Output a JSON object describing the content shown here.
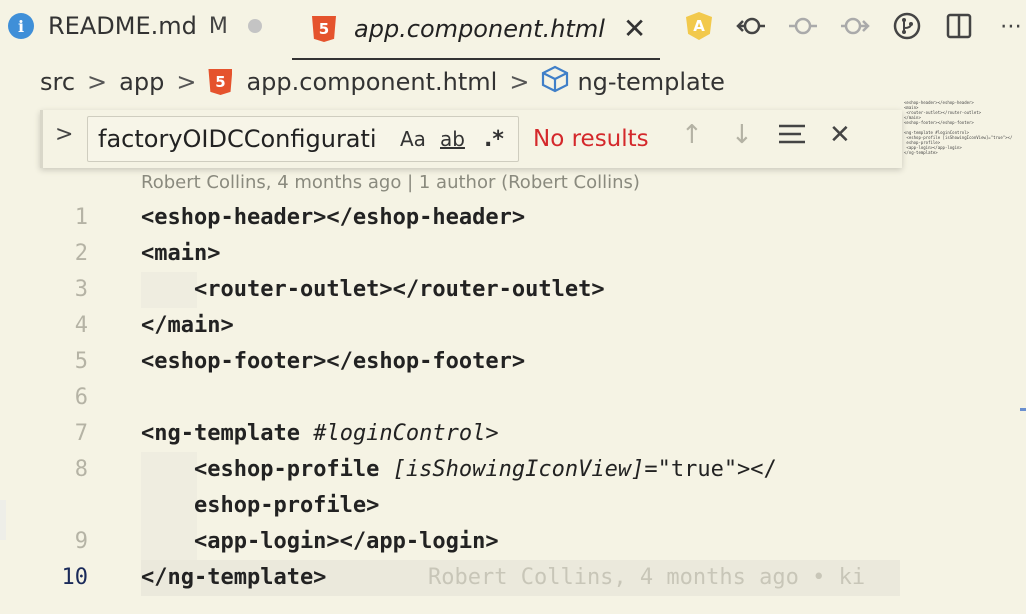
{
  "tabs": [
    {
      "label": "README.md",
      "modified": "M"
    },
    {
      "label": "app.component.html"
    }
  ],
  "breadcrumb": [
    "src",
    "app",
    "app.component.html",
    "ng-template"
  ],
  "find": {
    "value": "factoryOIDCConfigurati",
    "match_case": "Aa",
    "whole_word": "ab",
    "regex": ".*",
    "status": "No results"
  },
  "blame_header": "Robert Collins, 4 months ago | 1 author (Robert Collins)",
  "inline_blame": "Robert Collins, 4 months ago • ki",
  "line_numbers": [
    "1",
    "2",
    "3",
    "4",
    "5",
    "6",
    "7",
    "8",
    "9",
    "10"
  ],
  "code_lines": [
    "<eshop-header></eshop-header>",
    "<main>",
    "    <router-outlet></router-outlet>",
    "</main>",
    "<eshop-footer></eshop-footer>",
    "",
    "<ng-template #loginControl>",
    "    <eshop-profile [isShowingIconView]=\"true\"></",
    "    eshop-profile>",
    "    <app-login></app-login>",
    "</ng-template>"
  ],
  "colors": {
    "background": "#f5f3e4",
    "html_icon": "#e5532d",
    "error_text": "#d4282b",
    "info_icon": "#3f8fd8"
  }
}
